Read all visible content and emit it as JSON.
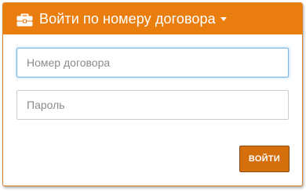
{
  "header": {
    "title": "Войти по номеру договора",
    "icon": "briefcase-icon",
    "dropdown_icon": "caret-down-icon",
    "background_color": "#e97e0e"
  },
  "form": {
    "contract_number": {
      "value": "",
      "placeholder": "Номер договора"
    },
    "password": {
      "value": "",
      "placeholder": "Пароль"
    },
    "submit_label": "ВОЙТИ"
  },
  "colors": {
    "accent": "#e97e0e",
    "button": "#d56f0b",
    "focus_border": "#74b5e6"
  }
}
